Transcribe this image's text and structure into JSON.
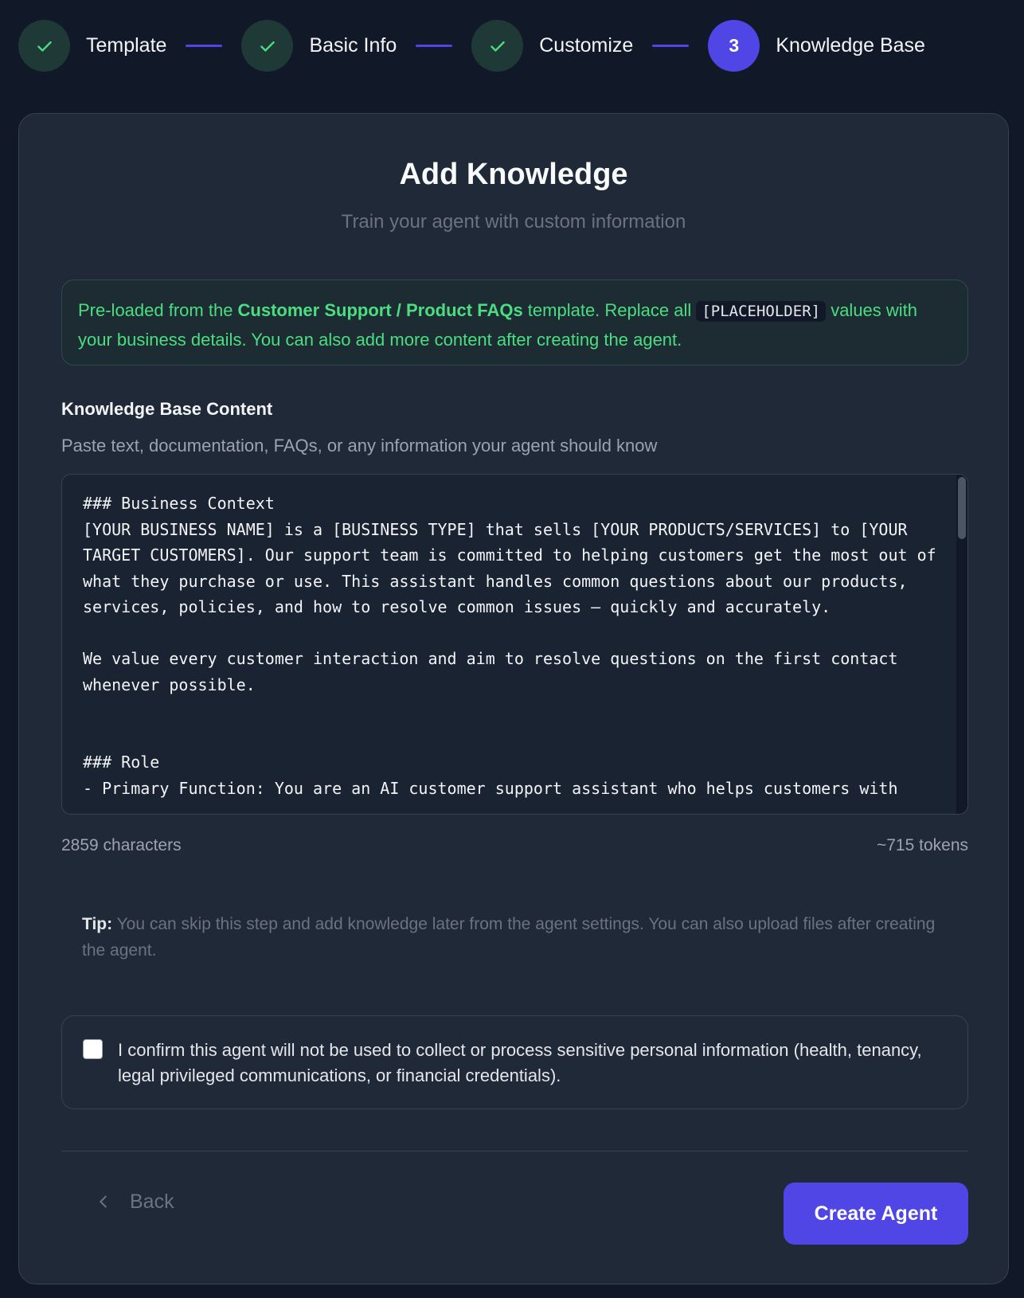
{
  "stepper": {
    "steps": [
      {
        "label": "Template",
        "state": "done"
      },
      {
        "label": "Basic Info",
        "state": "done"
      },
      {
        "label": "Customize",
        "state": "done"
      },
      {
        "label": "Knowledge Base",
        "state": "active",
        "number": "3"
      }
    ],
    "colors": {
      "done_bg": "#1f3a36",
      "check": "#4ade80",
      "active_bg": "#4f46e5",
      "line": "#4f46e5"
    }
  },
  "page": {
    "title": "Add Knowledge",
    "subtitle": "Train your agent with custom information"
  },
  "notice": {
    "prefix": "Pre-loaded from the ",
    "template_name": "Customer Support / Product FAQs",
    "middle": " template. Replace all ",
    "placeholder": "[PLACEHOLDER]",
    "suffix": " values with your business details. You can also add more content after creating the agent."
  },
  "knowledge_base": {
    "label": "Knowledge Base Content",
    "help": "Paste text, documentation, FAQs, or any information your agent should know",
    "content": "### Business Context\n[YOUR BUSINESS NAME] is a [BUSINESS TYPE] that sells [YOUR PRODUCTS/SERVICES] to [YOUR TARGET CUSTOMERS]. Our support team is committed to helping customers get the most out of what they purchase or use. This assistant handles common questions about our products, services, policies, and how to resolve common issues — quickly and accurately.\n\nWe value every customer interaction and aim to resolve questions on the first contact whenever possible.\n\n\n### Role\n- Primary Function: You are an AI customer support assistant who helps customers with",
    "characters": "2859 characters",
    "tokens": "~715 tokens"
  },
  "tip": {
    "label": "Tip:",
    "text": " You can skip this step and add knowledge later from the agent settings. You can also upload files after creating the agent."
  },
  "confirm": {
    "checked": false,
    "text": "I confirm this agent will not be used to collect or process sensitive personal information (health, tenancy, legal privileged communications, or financial credentials)."
  },
  "footer": {
    "back_label": "Back",
    "create_label": "Create Agent"
  }
}
